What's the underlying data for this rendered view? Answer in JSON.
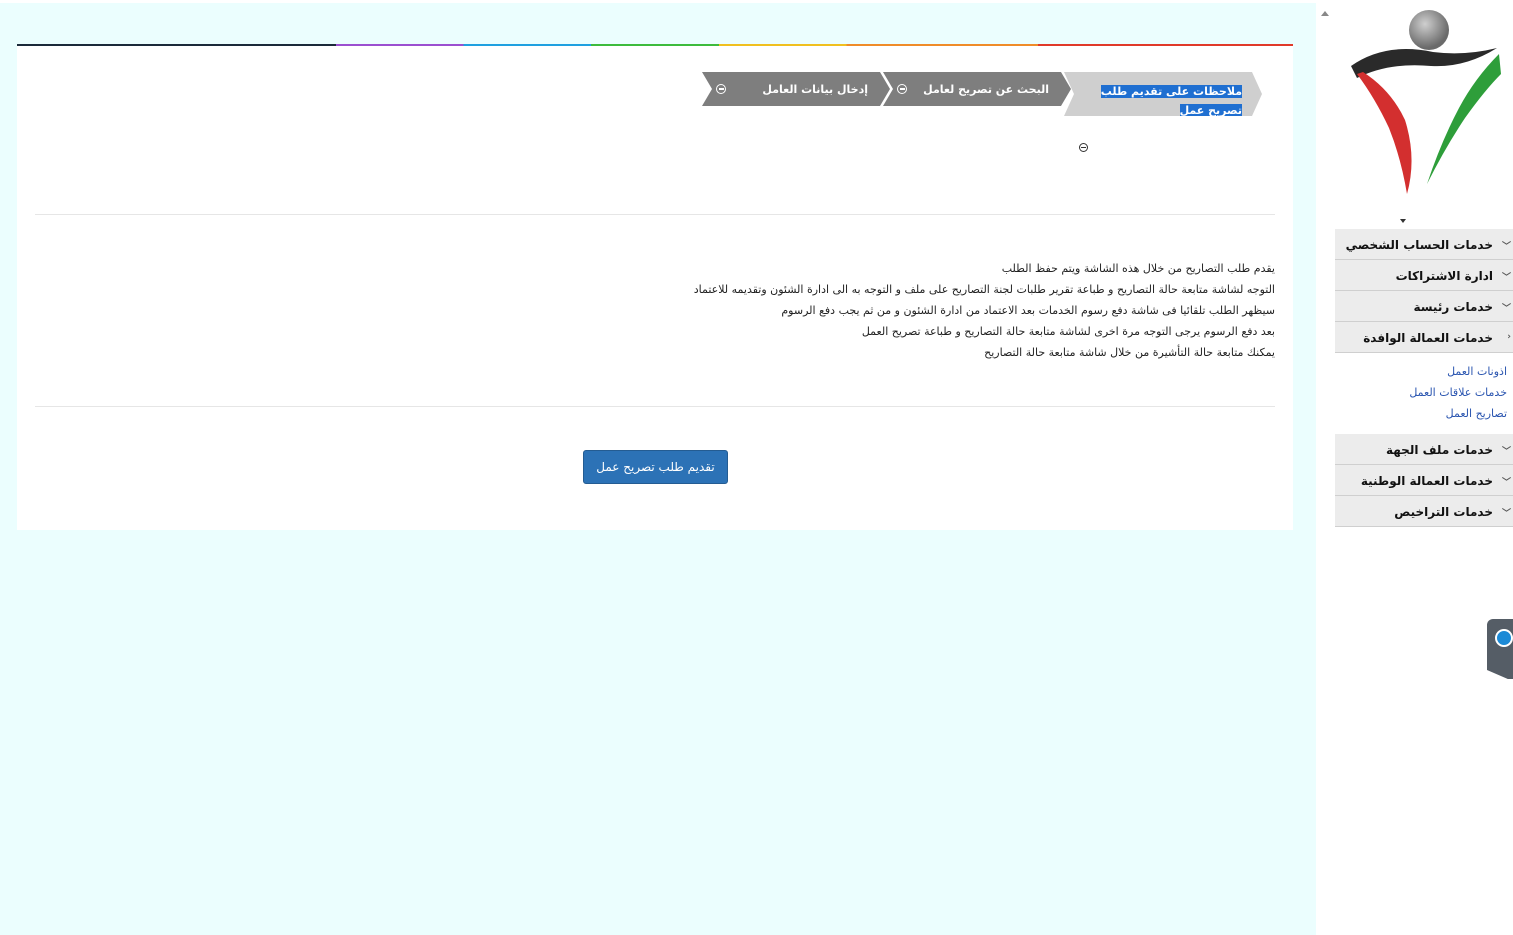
{
  "wizard": {
    "steps": [
      {
        "label": "ملاحظات على تقديم طلب تصريح عمل",
        "active": true
      },
      {
        "label": "البحث عن تصريح لعامل",
        "active": false
      },
      {
        "label": "إدخال بيانات العامل",
        "active": false
      }
    ]
  },
  "notes": [
    "يقدم طلب التصاريح من خلال هذه الشاشة ويتم حفظ الطلب",
    "التوجه لشاشة متابعة حالة التصاريح و طباعة تقرير طلبات لجنة التصاريح على ملف و التوجه به الى ادارة الشئون وتقديمه للاعتماد",
    "سيظهر الطلب تلقائيا فى شاشة دفع رسوم الخدمات بعد الاعتماد من ادارة الشئون و من ثم يجب دفع الرسوم",
    "بعد دفع الرسوم يرجى التوجه مرة اخرى لشاشة متابعة حالة التصاريح و طباعة تصريح العمل",
    "يمكنك متابعة حالة التأشيرة من خلال شاشة متابعة حالة التصاريح"
  ],
  "submit_label": "تقديم طلب تصريح عمل",
  "sidebar": {
    "menu_top": [
      {
        "label": "خدمات الحساب الشخصي",
        "expanded": false
      },
      {
        "label": "ادارة الاشتراكات",
        "expanded": false
      },
      {
        "label": "خدمات رئيسة",
        "expanded": false
      },
      {
        "label": "خدمات العمالة الوافدة",
        "expanded": true
      }
    ],
    "submenu": [
      "اذونات العمل",
      "خدمات علاقات العمل",
      "تصاريح العمل"
    ],
    "menu_bottom": [
      {
        "label": "خدمات ملف الجهة",
        "expanded": false
      },
      {
        "label": "خدمات العمالة الوطنية",
        "expanded": false
      },
      {
        "label": "خدمات التراخيص",
        "expanded": false
      }
    ],
    "chevron_collapsed": "﹀",
    "chevron_expanded": "‹"
  },
  "colors": {
    "accent": "#2c72b6",
    "page_bg": "#ebfefe",
    "selection": "#1f6fd1",
    "logo_red": "#d32f2f",
    "logo_green": "#2e9e3a"
  },
  "icons": {
    "step_icon": "minus-circle-icon",
    "logo": "person-figure-logo",
    "remote_widget": "teamviewer-icon"
  }
}
